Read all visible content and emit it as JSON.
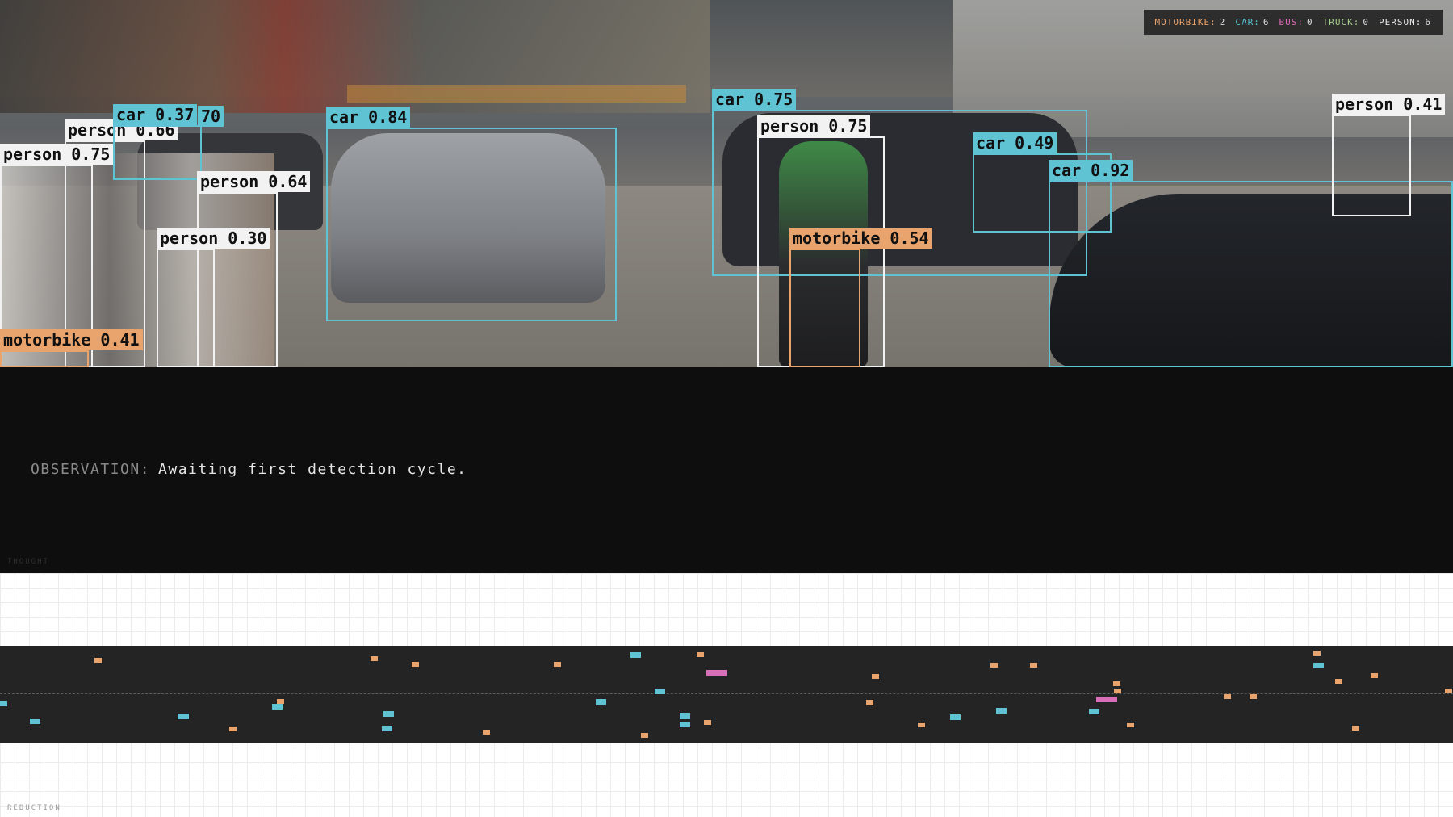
{
  "colors": {
    "car": "#5fc3d4",
    "person": "#f2f2f2",
    "motorbike": "#e9a36c",
    "bus": "#d86fb8",
    "truck": "#a8d08d",
    "panel_dark": "#0e0e0e",
    "track": "#242424"
  },
  "counts": [
    {
      "key": "MOTORBIKE:",
      "value": "2",
      "color": "#e9a36c"
    },
    {
      "key": "CAR:",
      "value": "6",
      "color": "#5fc3d4"
    },
    {
      "key": "BUS:",
      "value": "0",
      "color": "#d86fb8"
    },
    {
      "key": "TRUCK:",
      "value": "0",
      "color": "#a8d08d"
    },
    {
      "key": "PERSON:",
      "value": "6",
      "color": "#e6e6e6"
    }
  ],
  "detections": [
    {
      "label": "person 0.75",
      "cls": "person"
    },
    {
      "label": "person 0.66",
      "cls": "person"
    },
    {
      "label": "car 0.37",
      "cls": "car"
    },
    {
      "label": "70",
      "cls": "car"
    },
    {
      "label": "car 0.84",
      "cls": "car"
    },
    {
      "label": "person 0.64",
      "cls": "person"
    },
    {
      "label": "person 0.30",
      "cls": "person"
    },
    {
      "label": "motorbike 0.41",
      "cls": "motorbike"
    },
    {
      "label": "car 0.75",
      "cls": "car"
    },
    {
      "label": "person 0.75",
      "cls": "person"
    },
    {
      "label": "motorbike 0.54",
      "cls": "motorbike"
    },
    {
      "label": "car 0.49",
      "cls": "car"
    },
    {
      "label": "car 0.92",
      "cls": "car"
    },
    {
      "label": "person 0.41",
      "cls": "person"
    }
  ],
  "observation": {
    "key": "OBSERVATION:",
    "text": "Awaiting first detection cycle."
  },
  "section_tags": {
    "thought": "THOUGHT",
    "reduction": "REDUCTION"
  }
}
